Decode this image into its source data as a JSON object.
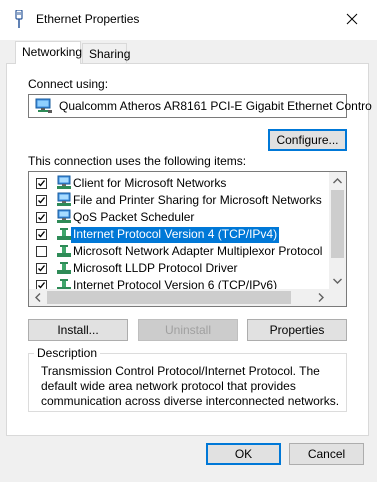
{
  "window": {
    "title": "Ethernet Properties",
    "close_glyph": "✕"
  },
  "tabs": [
    {
      "label": "Networking",
      "active": true
    },
    {
      "label": "Sharing",
      "active": false
    }
  ],
  "connect_using": {
    "label": "Connect using:",
    "adapter": "Qualcomm Atheros AR8161 PCI-E Gigabit Ethernet Contro",
    "configure_label": "Configure..."
  },
  "items_section": {
    "label": "This connection uses the following items:",
    "items": [
      {
        "label": "Client for Microsoft Networks",
        "checked": true,
        "icon": "network-client-icon",
        "selected": false
      },
      {
        "label": "File and Printer Sharing for Microsoft Networks",
        "checked": true,
        "icon": "network-service-icon",
        "selected": false
      },
      {
        "label": "QoS Packet Scheduler",
        "checked": true,
        "icon": "network-service-icon",
        "selected": false
      },
      {
        "label": "Internet Protocol Version 4 (TCP/IPv4)",
        "checked": true,
        "icon": "network-protocol-icon",
        "selected": true
      },
      {
        "label": "Microsoft Network Adapter Multiplexor Protocol",
        "checked": false,
        "icon": "network-protocol-icon",
        "selected": false
      },
      {
        "label": "Microsoft LLDP Protocol Driver",
        "checked": true,
        "icon": "network-protocol-icon",
        "selected": false
      },
      {
        "label": "Internet Protocol Version 6 (TCP/IPv6)",
        "checked": true,
        "icon": "network-protocol-icon",
        "selected": false
      }
    ]
  },
  "buttons": {
    "install": "Install...",
    "uninstall": "Uninstall",
    "properties": "Properties"
  },
  "description": {
    "title": "Description",
    "text": "Transmission Control Protocol/Internet Protocol. The default wide area network protocol that provides communication across diverse interconnected networks."
  },
  "footer": {
    "ok": "OK",
    "cancel": "Cancel"
  },
  "colors": {
    "selection": "#0078d7",
    "focus_border": "#0078d7"
  }
}
